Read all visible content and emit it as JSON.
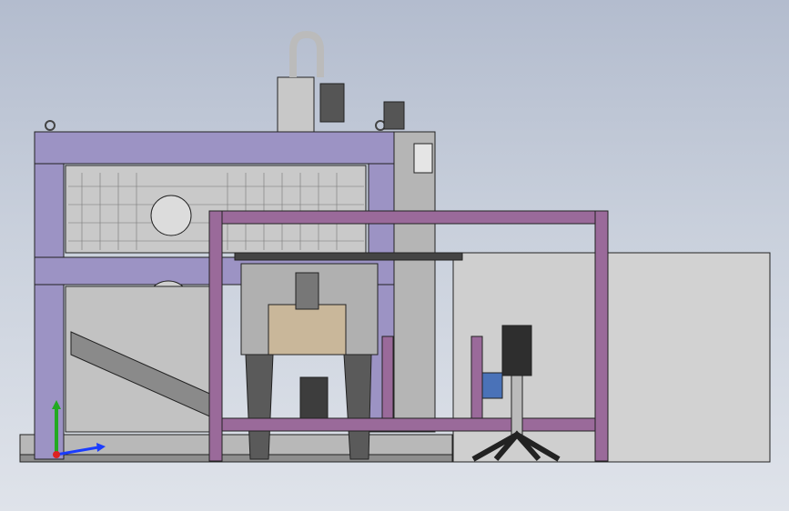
{
  "view": {
    "background_top": "#b3bcce",
    "background_bottom": "#dfe3ea",
    "frame_color": "#9c93c4",
    "rail_color": "#9a6a9a",
    "panel_color": "#cfcfcf",
    "dark_color": "#4a4a4a"
  },
  "triad": {
    "x_axis_color": "#1a3cff",
    "y_axis_color": "#22aa22",
    "z_axis_color": "#dd2222"
  },
  "icons": {
    "triad": "coordinate-triad-icon",
    "lifting_eye": "lifting-eye-icon",
    "motor": "motor-icon"
  }
}
